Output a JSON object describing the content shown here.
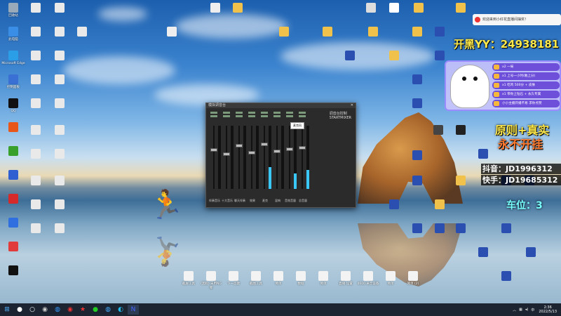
{
  "desktop": {
    "left_icons": [
      {
        "label": "回收站",
        "color": "#9ab"
      },
      {
        "label": "此电脑",
        "color": "#3a8ee6"
      },
      {
        "label": "Microsoft Edge",
        "color": "#2b9ee8"
      },
      {
        "label": "控制面板",
        "color": "#3a6fd4"
      },
      {
        "label": "QQ",
        "color": "#111"
      },
      {
        "label": "",
        "color": "#e8561a"
      },
      {
        "label": "",
        "color": "#39a12b"
      },
      {
        "label": "",
        "color": "#2f5fd0"
      },
      {
        "label": "",
        "color": "#d62a2a"
      },
      {
        "label": "",
        "color": "#2f6fe0"
      },
      {
        "label": "",
        "color": "#e23b3b"
      },
      {
        "label": "",
        "color": "#111"
      }
    ],
    "center_files": [
      "截屏工具",
      "(黑胶) 未用NG 库",
      "下一首歌",
      "截图工具",
      "简单",
      "数据",
      "简单",
      "直播 设置",
      "4600 采音设备",
      "简单",
      "简单 (2)"
    ]
  },
  "mixer": {
    "title": "模拟调音台",
    "logo_line1": "调音台控制",
    "logo_line2": "STARTMIXER",
    "tooltip": "麦克风",
    "channels": [
      {
        "label": "伴奏音乐",
        "fader": 0.62,
        "meter": 0.0
      },
      {
        "label": "十大音乐",
        "fader": 0.55,
        "meter": 0.0
      },
      {
        "label": "聊天伴奏",
        "fader": 0.7,
        "meter": 0.0
      },
      {
        "label": "效果",
        "fader": 0.58,
        "meter": 0.0
      },
      {
        "label": "麦克",
        "fader": 0.72,
        "meter": 0.35
      },
      {
        "label": "混响",
        "fader": 0.6,
        "meter": 0.0
      },
      {
        "label": "音效音量",
        "fader": 0.64,
        "meter": 0.25
      },
      {
        "label": "总音量",
        "fader": 0.66,
        "meter": 0.3
      }
    ]
  },
  "overlay": {
    "notification": "欢迎来到小红花直播间抽奖！",
    "yy": "开黑YY：24938181",
    "promo_rows": [
      "x2 一局",
      "x1 上号一小时(敢上分)",
      "x1 吃鸡 500分 + 皮肤",
      "x1 带你上钻石 + 永久专属",
      "小小主播开播不易 求你点赞"
    ],
    "slogan1": "原则+真实",
    "slogan2": "永不开挂",
    "douyin": "抖音：JD1996312",
    "kuaishou": "快手：JD19685312",
    "queue": "车位：3"
  },
  "taskbar": {
    "time": "2:36",
    "date": "2022/5/13"
  }
}
